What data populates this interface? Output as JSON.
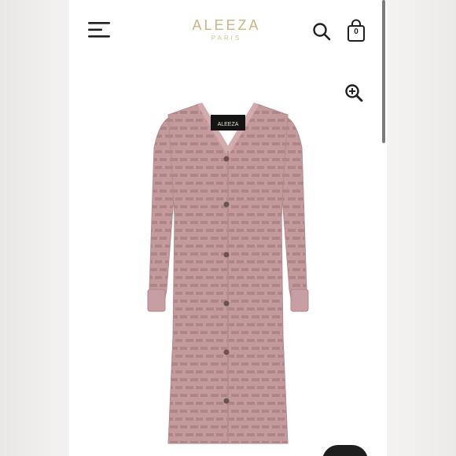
{
  "header": {
    "brand_name": "ALEEZA",
    "brand_sub": "PARIS",
    "cart_count": "0",
    "icons": [
      "menu-icon",
      "search-icon",
      "shopping-bag-icon",
      "zoom-in-icon"
    ]
  },
  "product": {
    "label_text": "ALEEZA",
    "dress_color": "#c49a9d"
  },
  "colors": {
    "brand_gold": "#c9b585",
    "icon_dark": "#1f1f1f"
  }
}
